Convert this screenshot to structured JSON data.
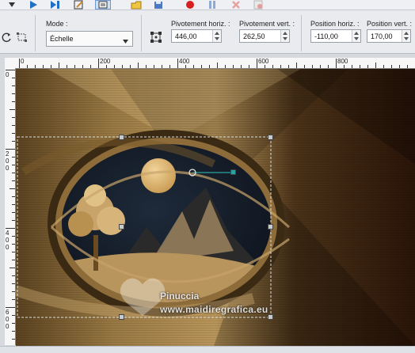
{
  "toolbar": {
    "icons": [
      "play-icon",
      "step-icon",
      "script-edit-icon",
      "script-editor-icon",
      "open-folder-icon",
      "save-icon",
      "record-icon",
      "pause-icon",
      "cancel-icon",
      "delete-script-icon"
    ]
  },
  "tool_options": {
    "mode_label": "Mode :",
    "mode_value": "Échelle",
    "pivot_h_label": "Pivotement horiz. :",
    "pivot_h_value": "446,00",
    "pivot_v_label": "Pivotement vert. :",
    "pivot_v_value": "262,50",
    "pos_h_label": "Position horiz. :",
    "pos_h_value": "-110,00",
    "pos_v_label": "Position vert. :",
    "pos_v_value": "170,00"
  },
  "ruler": {
    "h_labels": [
      "0",
      "200",
      "400",
      "600",
      "800"
    ],
    "v_labels": [
      "0",
      "2 0 0",
      "4 0 0",
      "6 0 0"
    ]
  },
  "watermark": {
    "line1": "Pinuccia",
    "line2": "www.maidiregrafica.eu"
  },
  "colors": {
    "accent": "#1f6fc5",
    "record": "#d81e1e",
    "handle_line": "#2aa3a0"
  }
}
